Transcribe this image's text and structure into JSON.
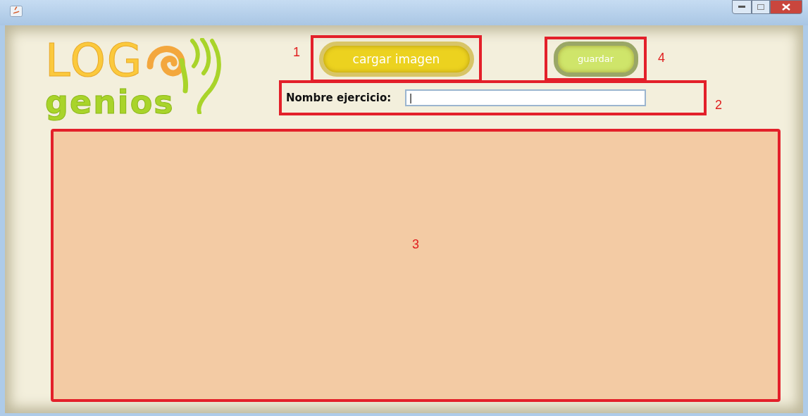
{
  "logo": {
    "word": "LOG",
    "subword": "genios"
  },
  "load_button": {
    "label": "cargar imagen",
    "annotation": "1"
  },
  "save_button": {
    "label": "guardar",
    "annotation": "4"
  },
  "name_field": {
    "label": "Nombre ejercicio:",
    "value": "|",
    "annotation": "2"
  },
  "canvas": {
    "annotation": "3"
  }
}
